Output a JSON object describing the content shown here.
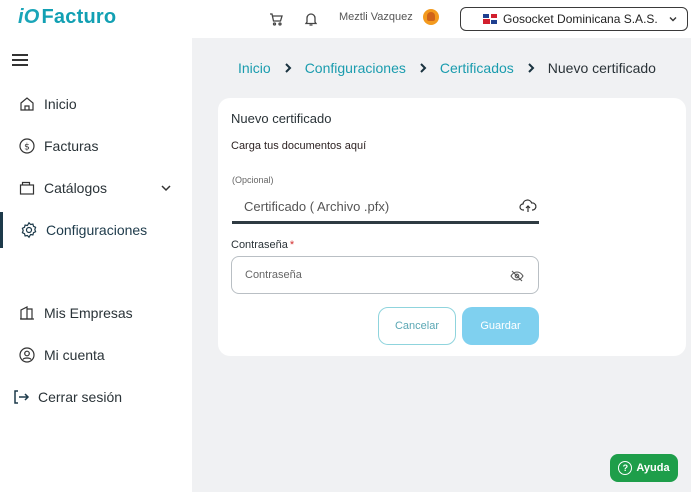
{
  "header": {
    "logo_prefix": "iO",
    "logo_brand": "Facturo",
    "user_name": "Meztli Vazquez",
    "company_name": "Gosocket Dominicana S.A.S."
  },
  "sidebar": {
    "items": [
      {
        "label": "Inicio",
        "icon": "home-icon"
      },
      {
        "label": "Facturas",
        "icon": "dollar-circle-icon"
      },
      {
        "label": "Catálogos",
        "icon": "folder-icon"
      },
      {
        "label": "Configuraciones",
        "icon": "gear-icon"
      },
      {
        "label": "Mis Empresas",
        "icon": "building-icon"
      },
      {
        "label": "Mi cuenta",
        "icon": "user-circle-icon"
      },
      {
        "label": "Cerrar sesión",
        "icon": "logout-icon"
      }
    ]
  },
  "breadcrumb": [
    {
      "label": "Inicio"
    },
    {
      "label": "Configuraciones"
    },
    {
      "label": "Certificados"
    },
    {
      "label": "Nuevo certificado"
    }
  ],
  "form": {
    "title": "Nuevo certificado",
    "subtitle": "Carga tus documentos aquí",
    "optional_label": "(Opcional)",
    "file_placeholder": "Certificado ( Archivo .pfx)",
    "password_label": "Contraseña",
    "password_required_mark": "*",
    "password_placeholder": "Contraseña",
    "cancel_label": "Cancelar",
    "save_label": "Guardar"
  },
  "help": {
    "label": "Ayuda"
  },
  "colors": {
    "accent": "#1a9cae",
    "save_button": "#7fd0ef",
    "help_button": "#1e9e4a"
  }
}
